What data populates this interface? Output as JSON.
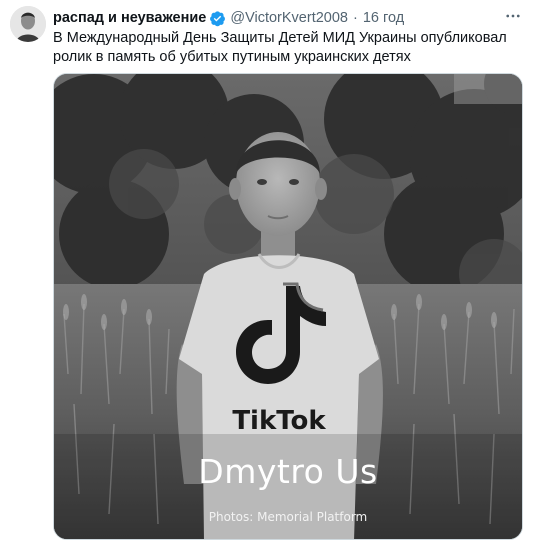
{
  "tweet": {
    "author_name": "распад и неуважение",
    "handle": "@VictorKvert2008",
    "separator": "·",
    "time": "16 год",
    "text": "В Международный День Защиты Детей МИД Украины опубликовал ролик в память об убитых путиным украинских детях",
    "verified": true
  },
  "media": {
    "overlay_name": "Dmytro Us",
    "credit": "Photos: Memorial Platform",
    "shirt_text": "TikTok"
  },
  "colors": {
    "text": "#0f1419",
    "secondary": "#536471",
    "verified": "#1d9bf0"
  },
  "icons": {
    "more": "more-horizontal-icon",
    "verified": "verified-badge-icon"
  }
}
